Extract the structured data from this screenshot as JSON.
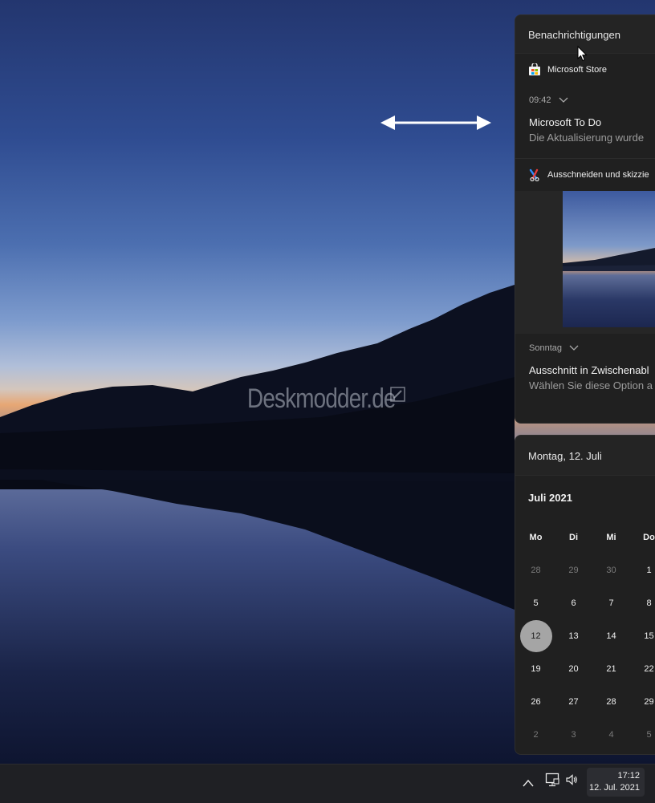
{
  "wallpaper": {
    "watermark": "Deskmodder.de"
  },
  "notifications": {
    "header": "Benachrichtigungen",
    "groups": [
      {
        "app": "Microsoft Store",
        "app_icon": "store-icon",
        "time": "09:42",
        "title": "Microsoft To Do",
        "body": "Die Aktualisierung wurde"
      },
      {
        "app": "Ausschneiden und skizzie",
        "app_icon": "snip-icon",
        "time": "Sonntag",
        "title": "Ausschnitt in Zwischenabl",
        "body": "Wählen Sie diese Option a"
      }
    ]
  },
  "calendar": {
    "header": "Montag, 12. Juli",
    "month": "Juli 2021",
    "weekdays": [
      "Mo",
      "Di",
      "Mi",
      "Do"
    ],
    "weeks": [
      [
        "28",
        "29",
        "30",
        "1"
      ],
      [
        "5",
        "6",
        "7",
        "8"
      ],
      [
        "12",
        "13",
        "14",
        "15"
      ],
      [
        "19",
        "20",
        "21",
        "22"
      ],
      [
        "26",
        "27",
        "28",
        "29"
      ],
      [
        "2",
        "3",
        "4",
        "5"
      ]
    ],
    "today": "12"
  },
  "taskbar": {
    "time": "17:12",
    "date": "12. Jul. 2021",
    "icons": [
      "chevron-up-icon",
      "network-icon",
      "volume-icon"
    ]
  },
  "colors": {
    "panel_bg": "#202020",
    "today_circle": "#a5a5a5",
    "taskbar_bg": "#1f2024"
  }
}
